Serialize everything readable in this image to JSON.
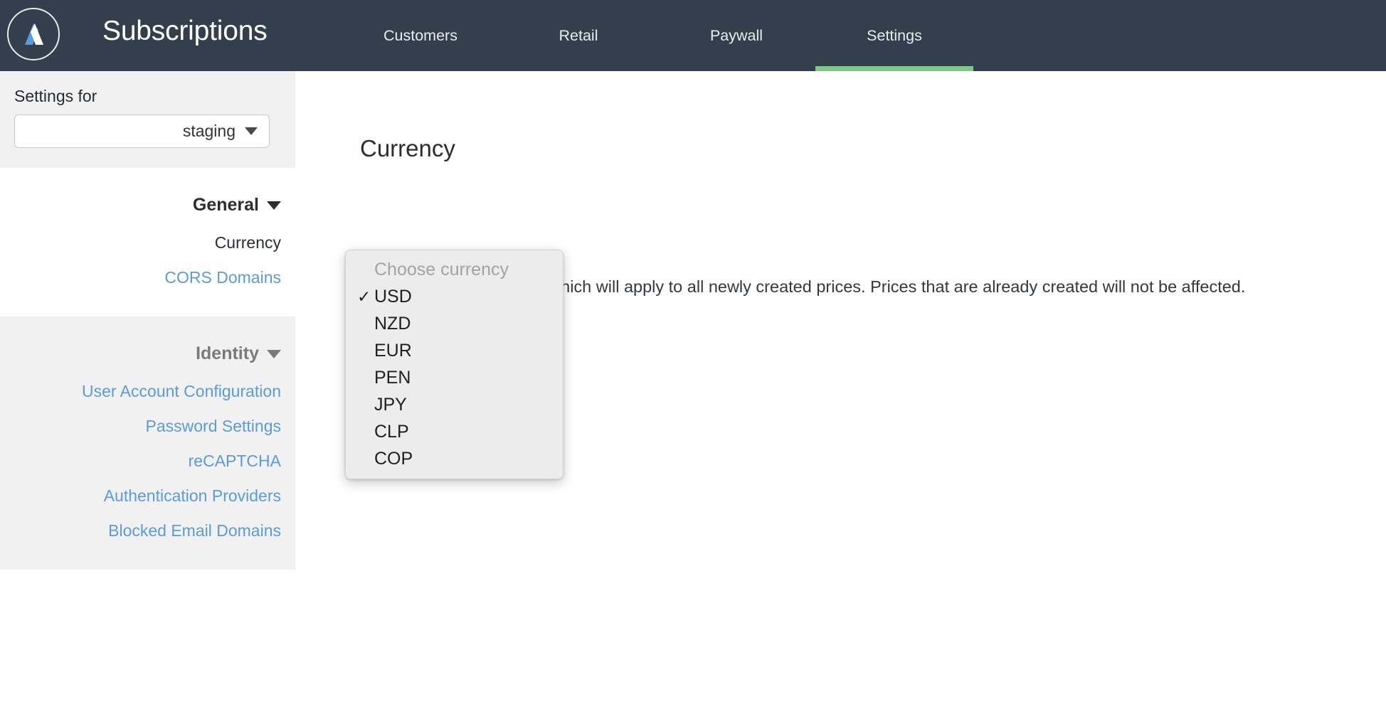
{
  "header": {
    "logo_icon": "company-a-logo-icon",
    "title": "Subscriptions",
    "nav_items": [
      {
        "label": "Customers",
        "active": false
      },
      {
        "label": "Retail",
        "active": false
      },
      {
        "label": "Paywall",
        "active": false
      },
      {
        "label": "Settings",
        "active": true
      }
    ],
    "background_color": "#333f4c",
    "active_indicator_color": "#7ec98a"
  },
  "sidebar": {
    "settings_for_label": "Settings for",
    "environment_select": {
      "value": "staging",
      "icon": "chevron-down-icon"
    },
    "sections": [
      {
        "title": "General",
        "collapse_icon": "chevron-down-icon",
        "items": [
          {
            "label": "Currency",
            "active": true
          },
          {
            "label": "CORS Domains",
            "active": false
          }
        ]
      },
      {
        "title": "Identity",
        "collapse_icon": "chevron-down-icon",
        "items": [
          {
            "label": "User Account Configuration",
            "active": false
          },
          {
            "label": "Password Settings",
            "active": false
          },
          {
            "label": "reCAPTCHA",
            "active": false
          },
          {
            "label": "Authentication Providers",
            "active": false
          },
          {
            "label": "Blocked Email Domains",
            "active": false
          }
        ]
      }
    ],
    "link_color": "#5b9bd9"
  },
  "main": {
    "title": "Currency",
    "description": "Select a default currency which will apply to all newly created prices. Prices that are already created will not be affected."
  },
  "currency_popup": {
    "placeholder": "Choose currency",
    "checkmark_icon": "check-icon",
    "options": [
      {
        "label": "USD",
        "selected": true
      },
      {
        "label": "NZD",
        "selected": false
      },
      {
        "label": "EUR",
        "selected": false
      },
      {
        "label": "PEN",
        "selected": false
      },
      {
        "label": "JPY",
        "selected": false
      },
      {
        "label": "CLP",
        "selected": false
      },
      {
        "label": "COP",
        "selected": false
      }
    ]
  }
}
